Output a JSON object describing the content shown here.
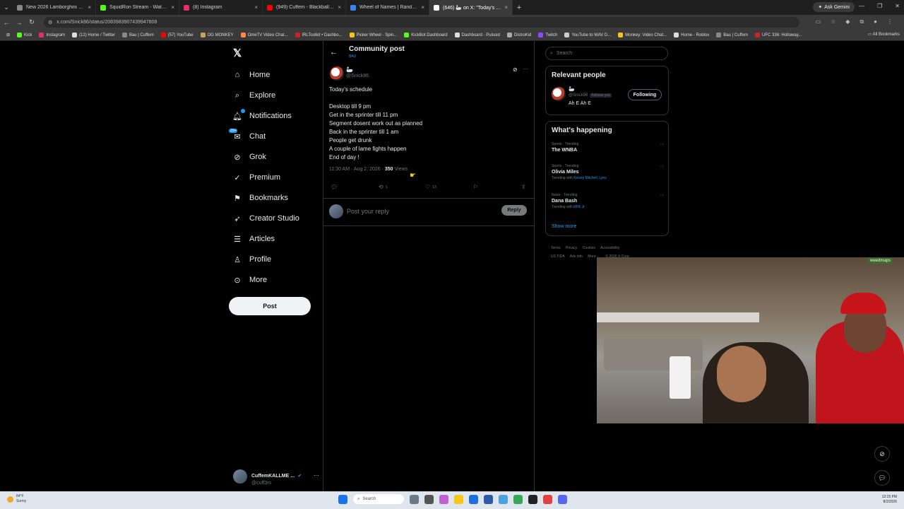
{
  "browser": {
    "tabs": [
      {
        "title": "New 2026 Lamborghini Urus S...",
        "color": "#888888",
        "active": false
      },
      {
        "title": "SquidRon Stream - Watch Live...",
        "color": "#53fc18",
        "active": false
      },
      {
        "title": "(8) Instagram",
        "color": "#e1306c",
        "active": false
      },
      {
        "title": "(949) Cuffem - Blackballed (St...",
        "color": "#ff0000",
        "active": false
      },
      {
        "title": "Wheel of Names | Random nam...",
        "color": "#3b82f6",
        "active": false
      },
      {
        "title": "(646) 🦢 on X: \"Today's schedu...",
        "color": "#ffffff",
        "active": true
      }
    ],
    "ask_gemini": "Ask Gemini",
    "url": "x.com/Snick86/status/2083983907439947808",
    "bookmarks": [
      {
        "label": "Kick",
        "color": "#53fc18"
      },
      {
        "label": "Instagram",
        "color": "#e1306c"
      },
      {
        "label": "(12) Home / Twitter",
        "color": "#dddddd"
      },
      {
        "label": "Bau | Cuffem",
        "color": "#888888"
      },
      {
        "label": "(57) YouTube",
        "color": "#ff0000"
      },
      {
        "label": "OG MONKEY",
        "color": "#c8a060"
      },
      {
        "label": "OmeTV Video Chat...",
        "color": "#ff8844"
      },
      {
        "label": "IRLToolkit • Dashbo...",
        "color": "#cc2222"
      },
      {
        "label": "Picker Wheel - Spin...",
        "color": "#f5c518"
      },
      {
        "label": "KickBot Dashboard",
        "color": "#53fc18"
      },
      {
        "label": "Dashboard - Pulsoid",
        "color": "#dddddd"
      },
      {
        "label": "DistroKid",
        "color": "#aaaaaa"
      },
      {
        "label": "Twitch",
        "color": "#9146ff"
      },
      {
        "label": "YouTube to WAV D...",
        "color": "#cccccc"
      },
      {
        "label": "Monkey: Video Chat...",
        "color": "#f5c518"
      },
      {
        "label": "Home - Roblox",
        "color": "#dddddd"
      },
      {
        "label": "Bau | Cuffem",
        "color": "#888888"
      },
      {
        "label": "UFC 336: Holloway...",
        "color": "#cc2222"
      }
    ],
    "all_bookmarks": "All Bookmarks"
  },
  "nav": {
    "items": [
      {
        "label": "Home",
        "icon": "home-icon"
      },
      {
        "label": "Explore",
        "icon": "search-icon"
      },
      {
        "label": "Notifications",
        "icon": "bell-icon"
      },
      {
        "label": "Chat",
        "icon": "chat-icon"
      },
      {
        "label": "Grok",
        "icon": "grok-icon"
      },
      {
        "label": "Premium",
        "icon": "premium-icon"
      },
      {
        "label": "Bookmarks",
        "icon": "bookmark-icon"
      },
      {
        "label": "Creator Studio",
        "icon": "rocket-icon"
      },
      {
        "label": "Articles",
        "icon": "articles-icon"
      },
      {
        "label": "Profile",
        "icon": "person-icon"
      },
      {
        "label": "More",
        "icon": "more-icon"
      }
    ],
    "chat_badge": "20+",
    "post_button": "Post",
    "account": {
      "name": "CuffemKALLME ...",
      "handle": "@cuff3m"
    }
  },
  "post": {
    "header_title": "Community post",
    "header_sub": "BAU",
    "author_name": "🦢",
    "author_handle": "@Snick86",
    "lines": [
      "Today's schedule",
      "",
      "Desktop till 9 pm",
      "Get in the sprinter till 11 pm",
      "Segment dosent work out as planned",
      "Back in the sprinter till 1 am",
      "People get drunk",
      "A couple of lame fights happen",
      "End of day !"
    ],
    "time": "11:30 AM · Aug 2, 2026 · ",
    "views_count": "350",
    "views_label": " Views",
    "reposts": "1",
    "likes": "13",
    "reply_placeholder": "Post your reply",
    "reply_button": "Reply"
  },
  "sidebar": {
    "search_placeholder": "Search",
    "relevant_title": "Relevant people",
    "person": {
      "name": "🦢",
      "handle": "@Snick86",
      "follows_you": "Follows you",
      "bio": "Ah E Ah E",
      "button": "Following"
    },
    "happening_title": "What's happening",
    "trends": [
      {
        "category": "Sports · Trending",
        "name": "The WNBA",
        "with_prefix": "",
        "with": ""
      },
      {
        "category": "Sports · Trending",
        "name": "Olivia Miles",
        "with_prefix": "Trending with ",
        "with": "Kelsey Mitchell, Lynx"
      },
      {
        "category": "News · Trending",
        "name": "Dana Bash",
        "with_prefix": "Trending with ",
        "with": "RFK Jr"
      }
    ],
    "show_more": "Show more",
    "footer": [
      "Terms",
      "Privacy",
      "Cookies",
      "Accessibility",
      "US TIDA",
      "Ads info",
      "More ···",
      "© 2026 X Corp."
    ]
  },
  "webcam": {
    "sign": "weedmaps"
  },
  "taskbar": {
    "temp": "84°F",
    "condition": "Sunny",
    "search": "Search",
    "time": "12:15 PM",
    "date": "8/2/2026"
  }
}
